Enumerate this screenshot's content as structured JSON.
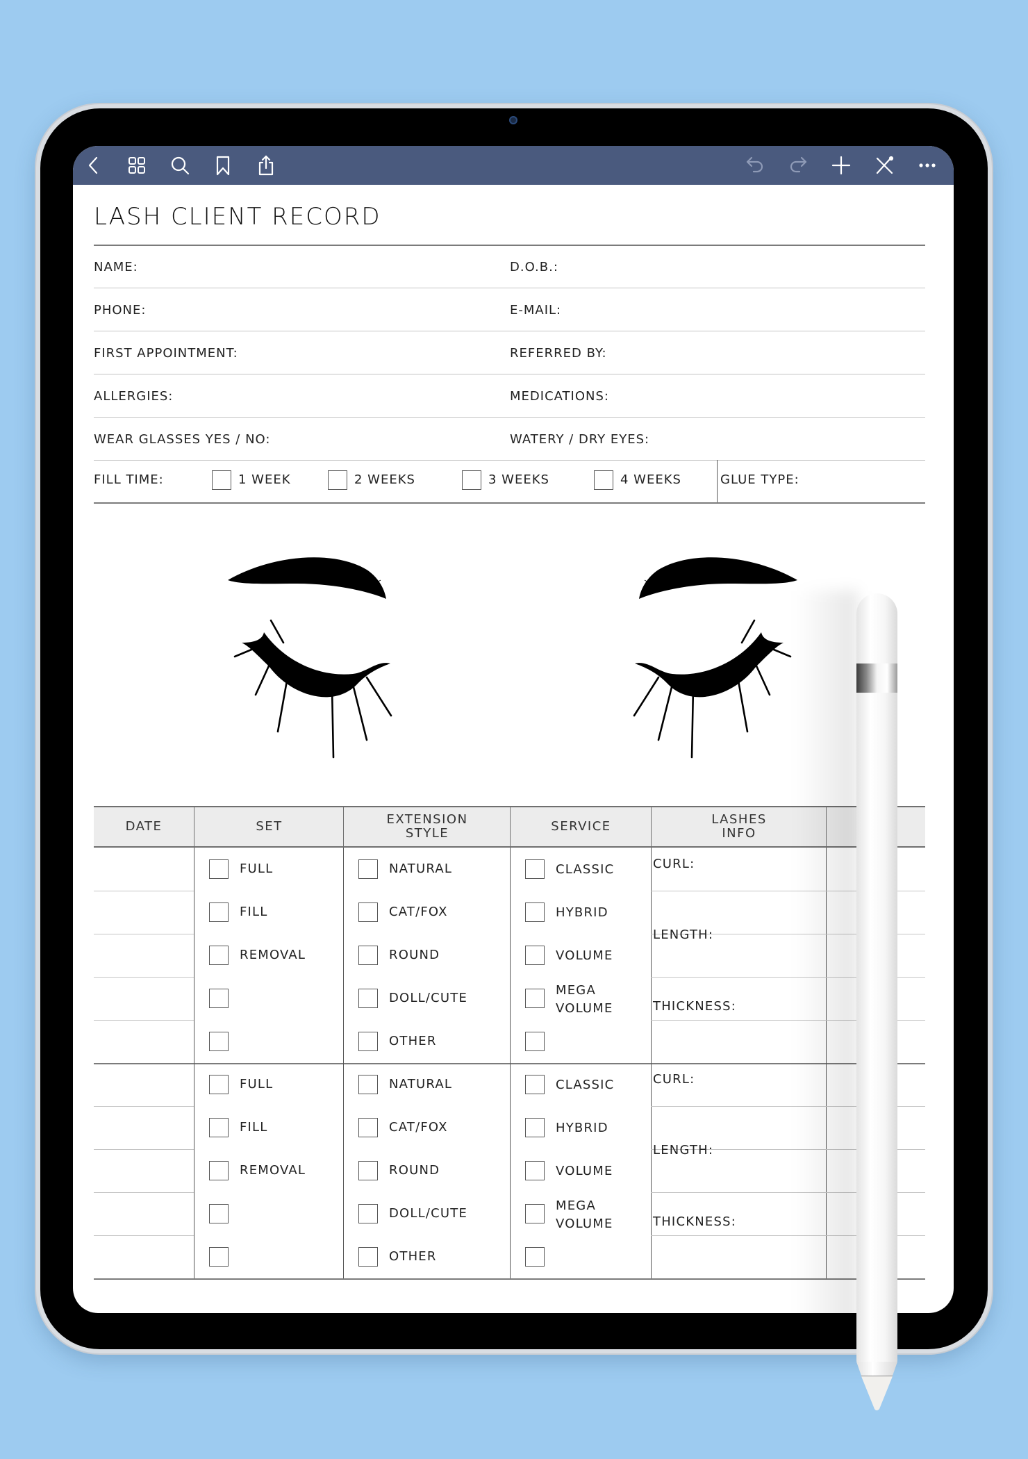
{
  "app": {
    "toolbar": {
      "left_icons": [
        "back-icon",
        "grid-icon",
        "search-icon",
        "bookmark-icon",
        "share-icon"
      ],
      "right_icons": [
        "undo-icon",
        "redo-icon",
        "add-icon",
        "pencil-close-icon",
        "more-icon"
      ],
      "color": "#4a5a7e"
    }
  },
  "page": {
    "title": "LASH CLIENT RECORD",
    "fields": [
      {
        "left": "NAME:",
        "right": "D.O.B.:"
      },
      {
        "left": "PHONE:",
        "right": "E-MAIL:"
      },
      {
        "left": "FIRST APPOINTMENT:",
        "right": "REFERRED BY:"
      },
      {
        "left": "ALLERGIES:",
        "right": "MEDICATIONS:"
      },
      {
        "left": "WEAR GLASSES YES / NO:",
        "right": "WATERY / DRY EYES:"
      }
    ],
    "fill_time": {
      "label": "FILL TIME:",
      "options": [
        "1 WEEK",
        "2 WEEKS",
        "3 WEEKS",
        "4 WEEKS"
      ],
      "glue_label": "GLUE TYPE:"
    },
    "table": {
      "headers": [
        "DATE",
        "SET",
        "EXTENSION\nSTYLE",
        "SERVICE",
        "LASHES\nINFO",
        ""
      ],
      "set_options": [
        "FULL",
        "FILL",
        "REMOVAL",
        "",
        ""
      ],
      "style_options": [
        "NATURAL",
        "CAT/FOX",
        "ROUND",
        "DOLL/CUTE",
        "OTHER"
      ],
      "service_options": [
        "CLASSIC",
        "HYBRID",
        "VOLUME",
        "MEGA\nVOLUME",
        ""
      ],
      "lash_info_labels": [
        "CURL:",
        "LENGTH:",
        "THICKNESS:"
      ],
      "blocks": 2
    }
  }
}
